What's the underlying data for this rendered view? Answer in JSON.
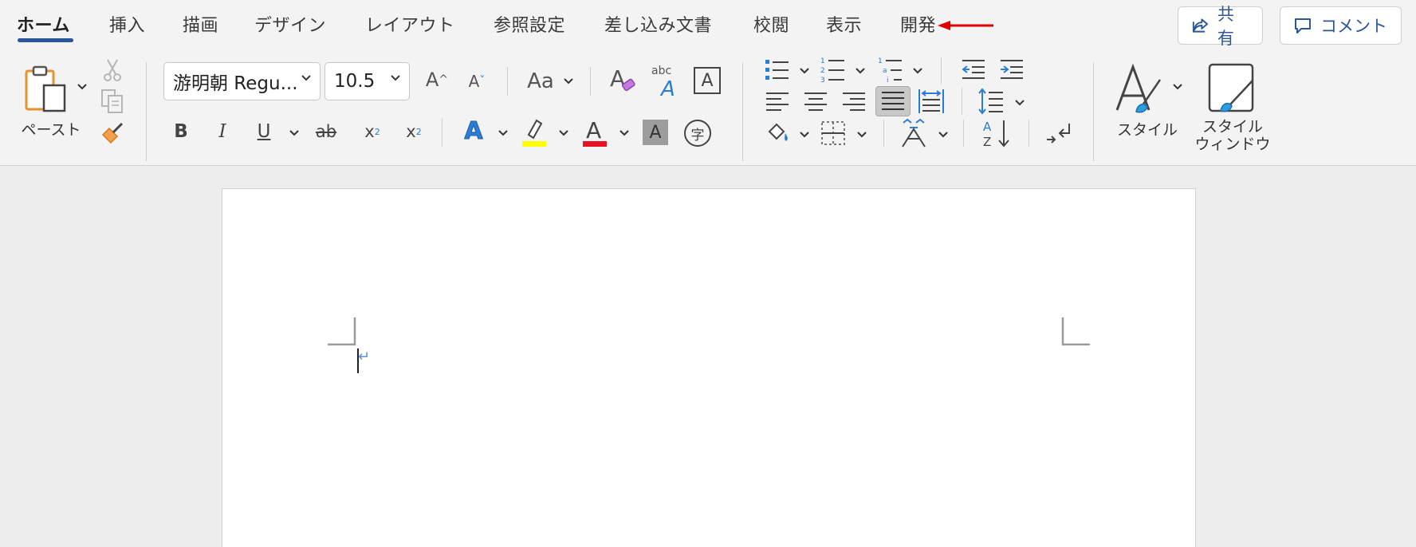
{
  "tabs": [
    {
      "label": "ホーム",
      "active": true
    },
    {
      "label": "挿入"
    },
    {
      "label": "描画"
    },
    {
      "label": "デザイン"
    },
    {
      "label": "レイアウト"
    },
    {
      "label": "参照設定"
    },
    {
      "label": "差し込み文書"
    },
    {
      "label": "校閲"
    },
    {
      "label": "表示"
    },
    {
      "label": "開発"
    }
  ],
  "share_label": "共有",
  "comment_label": "コメント",
  "clipboard": {
    "paste_label": "ペースト"
  },
  "font": {
    "name": "游明朝 Regu...",
    "size": "10.5"
  },
  "styles": {
    "style_label": "スタイル",
    "window_label_1": "スタイル",
    "window_label_2": "ウィンドウ"
  },
  "colors": {
    "accent": "#2b579a",
    "arrow": "#e00000",
    "highlight": "#ffff00",
    "font_color": "#e81123"
  },
  "doc": {
    "paragraph_mark": "↵"
  }
}
